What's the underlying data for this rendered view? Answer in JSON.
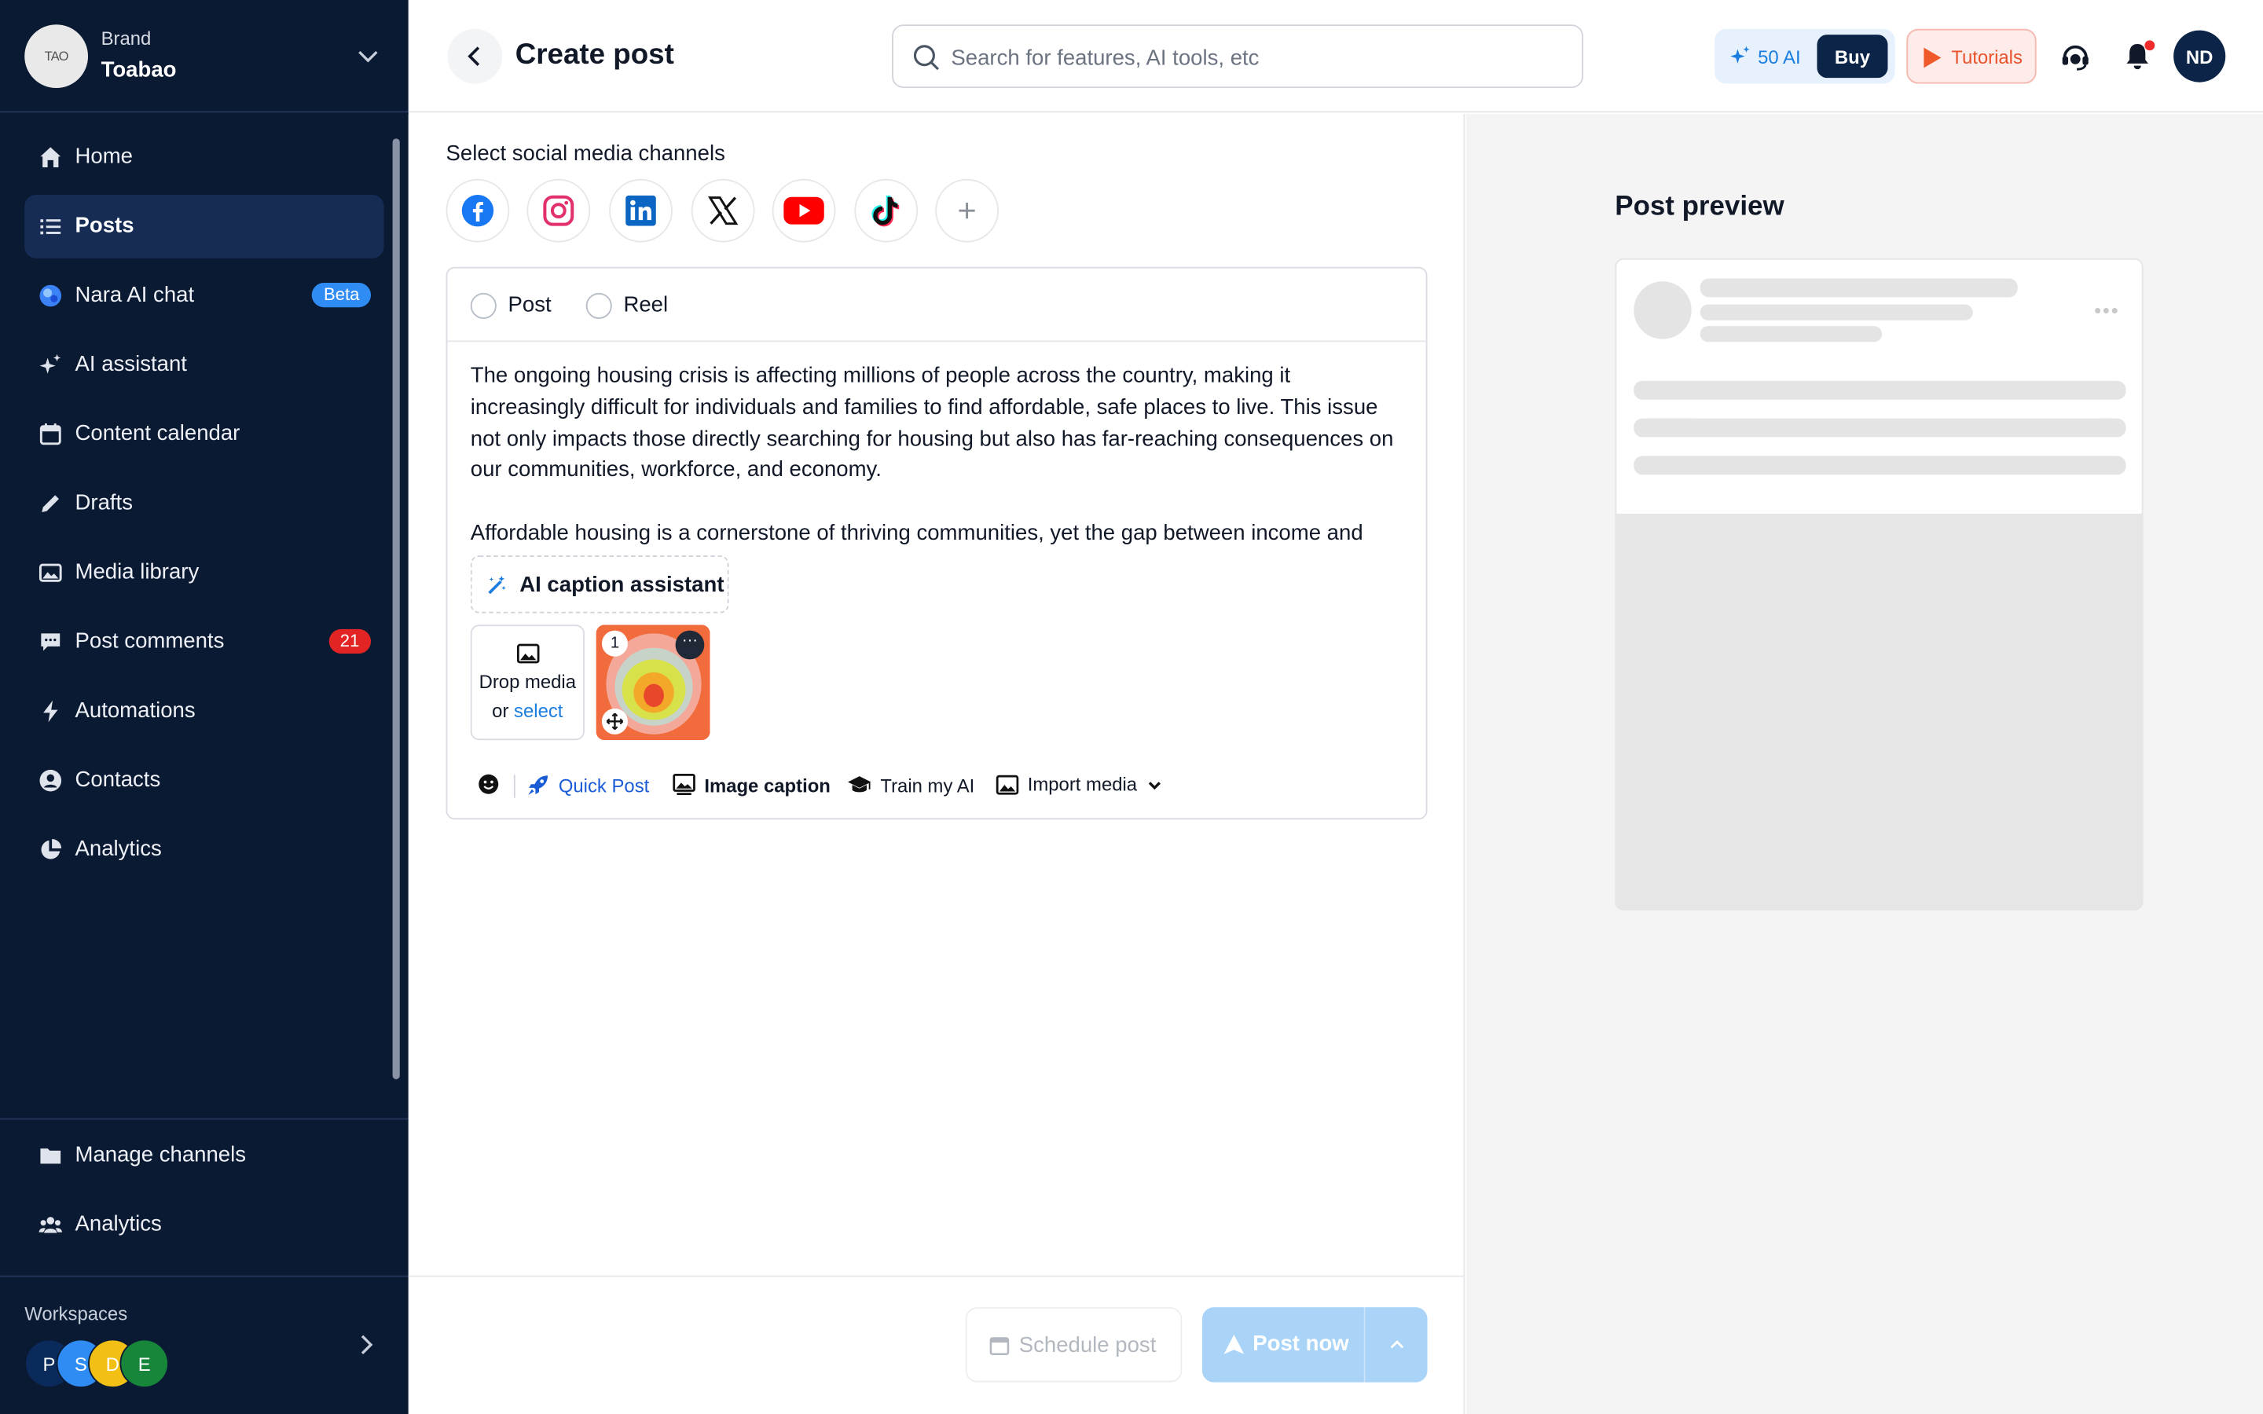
{
  "brand": {
    "label": "Brand",
    "name": "Toabao",
    "logo_text": "TAO"
  },
  "sidebar": {
    "items": [
      {
        "label": "Home",
        "icon": "home-icon"
      },
      {
        "label": "Posts",
        "icon": "list-icon",
        "active": true
      },
      {
        "label": "Nara AI chat",
        "icon": "globe-icon",
        "badge": "Beta"
      },
      {
        "label": "AI assistant",
        "icon": "sparkle-icon"
      },
      {
        "label": "Content calendar",
        "icon": "calendar-icon"
      },
      {
        "label": "Drafts",
        "icon": "pencil-icon"
      },
      {
        "label": "Media library",
        "icon": "image-icon"
      },
      {
        "label": "Post comments",
        "icon": "comment-icon",
        "count": "21"
      },
      {
        "label": "Automations",
        "icon": "bolt-icon"
      },
      {
        "label": "Contacts",
        "icon": "user-circle-icon"
      },
      {
        "label": "Analytics",
        "icon": "pie-chart-icon"
      }
    ],
    "bottom_items": [
      {
        "label": "Manage channels",
        "icon": "folder-icon"
      },
      {
        "label": "Analytics",
        "icon": "users-icon"
      }
    ],
    "workspaces": {
      "label": "Workspaces",
      "avatars": [
        {
          "letter": "P",
          "color": "#0b2a5c"
        },
        {
          "letter": "S",
          "color": "#2f8cf5"
        },
        {
          "letter": "D",
          "color": "#f2c014"
        },
        {
          "letter": "E",
          "color": "#17853a"
        }
      ]
    }
  },
  "header": {
    "title": "Create post",
    "search_placeholder": "Search for features, AI tools, etc",
    "ai_credits": "50 AI",
    "buy": "Buy",
    "tutorials": "Tutorials",
    "avatar_initials": "ND"
  },
  "composer": {
    "channels_label": "Select social media channels",
    "channels": [
      "facebook-icon",
      "instagram-icon",
      "linkedin-icon",
      "x-icon",
      "youtube-icon",
      "tiktok-icon",
      "add-channel-icon"
    ],
    "type_options": [
      "Post",
      "Reel"
    ],
    "text": "The ongoing housing crisis is affecting millions of people across the country, making it increasingly difficult for individuals and families to find affordable, safe places to live. This issue not only impacts those directly searching for housing but also has far-reaching consequences on our communities, workforce, and economy.\n\nAffordable housing is a cornerstone of thriving communities, yet the gap between income and",
    "ai_caption": "AI caption assistant",
    "drop_media": "Drop media",
    "drop_or": "or ",
    "drop_select": "select",
    "media_index": "1",
    "toolbar": {
      "quick_post": "Quick Post",
      "image_caption": "Image caption",
      "train_ai": "Train my AI",
      "import_media": "Import media"
    },
    "schedule": "Schedule post",
    "post_now": "Post now"
  },
  "preview": {
    "title": "Post preview"
  },
  "colors": {
    "sidebar_bg": "#0b1a33",
    "accent": "#1a7de0",
    "post_now": "#a9d4f7",
    "danger": "#e22424"
  }
}
